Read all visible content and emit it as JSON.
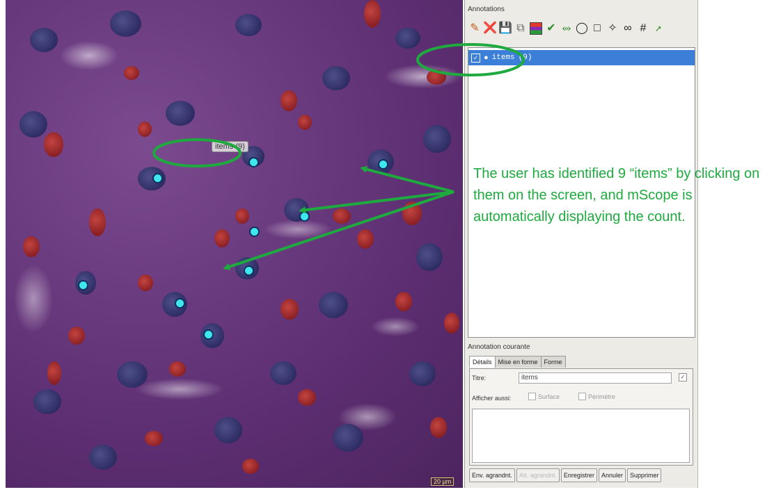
{
  "viewer": {
    "tooltip_label": "items (9)",
    "scale_label": "20 µm",
    "markers": [
      {
        "id": 1
      },
      {
        "id": 2
      },
      {
        "id": 3
      },
      {
        "id": 4
      },
      {
        "id": 5
      },
      {
        "id": 6
      },
      {
        "id": 7
      },
      {
        "id": 8
      },
      {
        "id": 9
      }
    ]
  },
  "panel": {
    "title": "Annotations",
    "toolbar_icons": [
      "edit-icon",
      "delete-icon",
      "save-icon",
      "copy-icon",
      "color-icon",
      "point-icon",
      "polyline-icon",
      "ellipse-icon",
      "rectangle-icon",
      "freehand-icon",
      "lasso-icon",
      "grid-icon",
      "counter-icon"
    ],
    "layer": {
      "checked": true,
      "name": "items",
      "count": "(9)"
    },
    "current_annotation_label": "Annotation courante",
    "tabs": [
      "Détails",
      "Mise en forme",
      "Forme"
    ],
    "details": {
      "titre_label": "Titre:",
      "titre_value": "items",
      "afficher_label": "Afficher aussi:",
      "surface_label": "Surface",
      "perimetre_label": "Périmètre"
    },
    "buttons": {
      "env_agrandissement": "Env. agrandnt.",
      "att_agrandissement": "Att. agrandnt.",
      "enregistrer": "Enregistrer",
      "annuler": "Annuler",
      "supprimer": "Supprimer"
    }
  },
  "callout": {
    "text": "The user has identified 9 “items” by clicking on them on the screen, and mScope is automatically displaying the count.",
    "color": "#1eaa3e"
  }
}
